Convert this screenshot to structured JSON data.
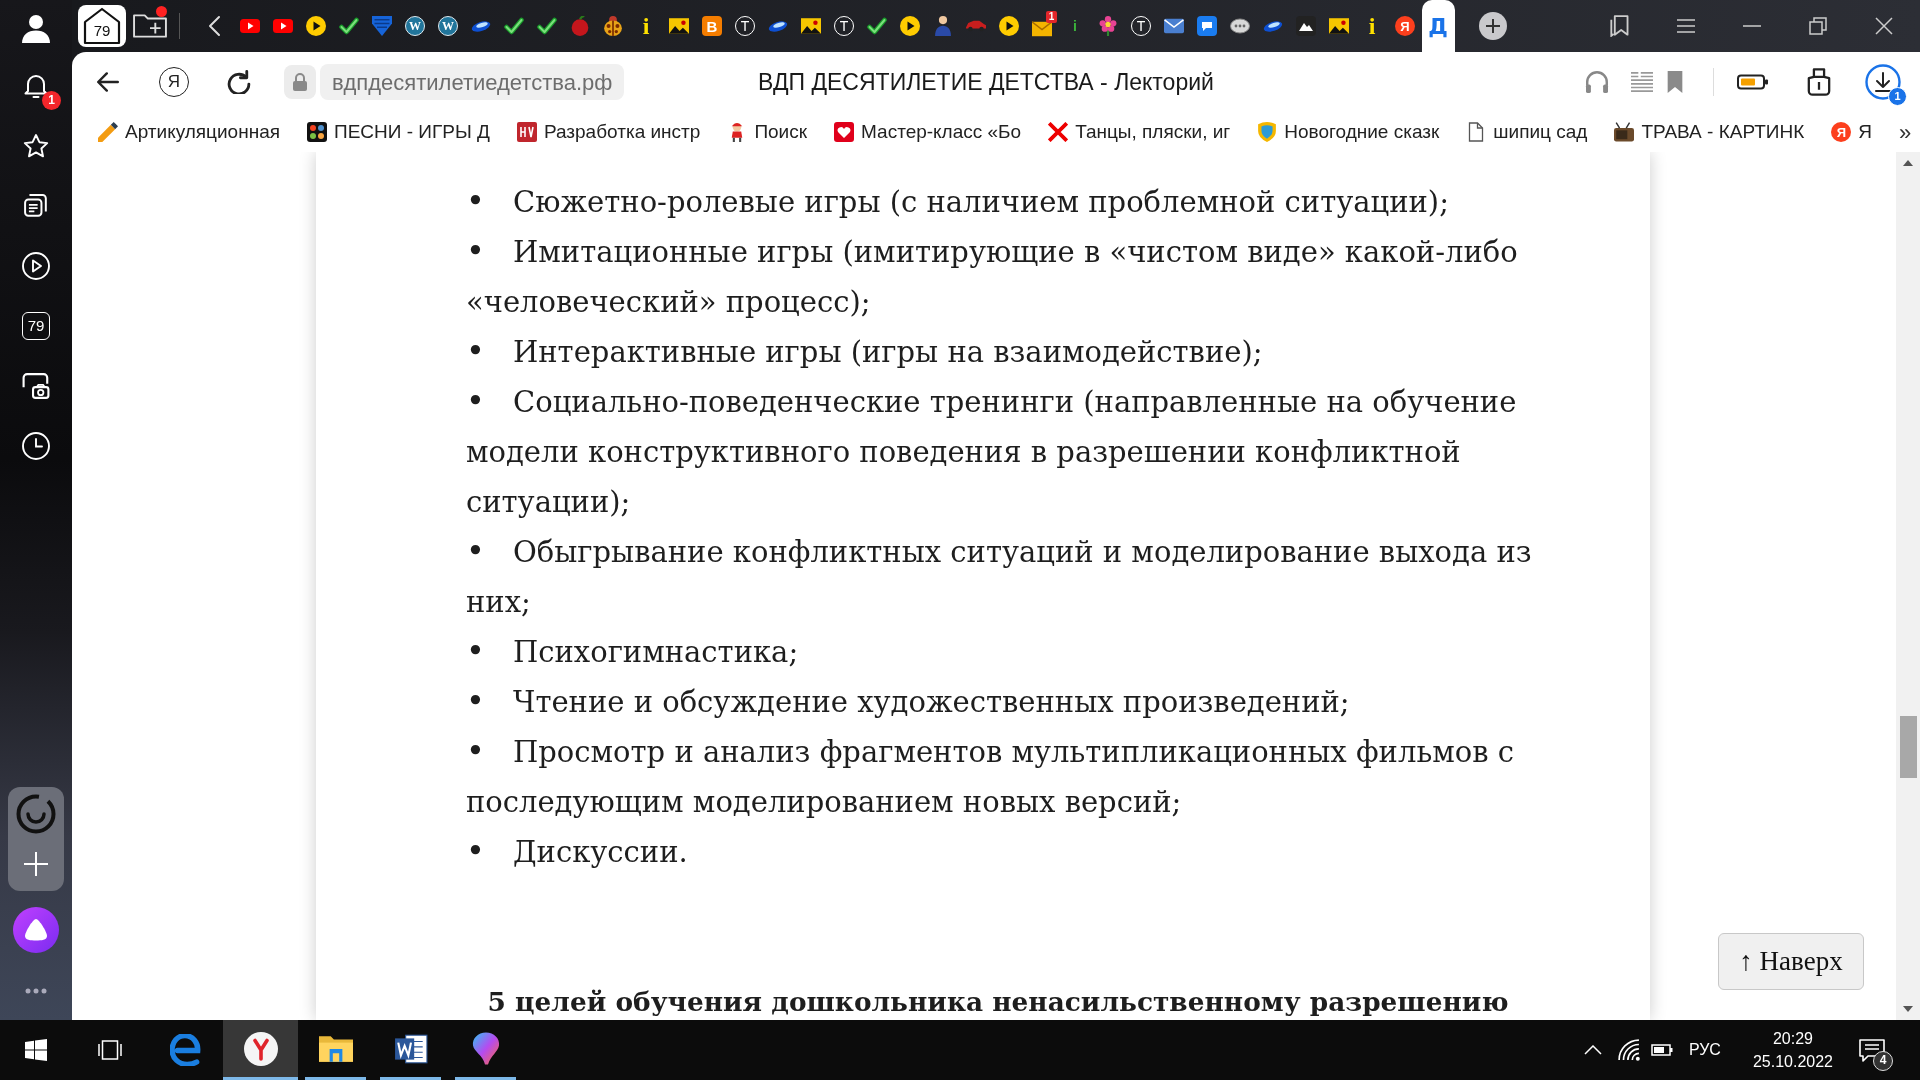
{
  "sidebar": {
    "notification_count": "1",
    "tab_count": "79"
  },
  "tab_strip": {
    "tabs_button": "79",
    "tabs": [
      {
        "kind": "youtube",
        "selected": false
      },
      {
        "kind": "youtube",
        "selected": false
      },
      {
        "kind": "play",
        "selected": false
      },
      {
        "kind": "check",
        "selected": false
      },
      {
        "kind": "shield",
        "selected": false
      },
      {
        "kind": "wordpress",
        "glyph": "W",
        "selected": false
      },
      {
        "kind": "wordpress",
        "glyph": "W",
        "selected": false
      },
      {
        "kind": "swoosh",
        "selected": false
      },
      {
        "kind": "check",
        "selected": false
      },
      {
        "kind": "check",
        "selected": false
      },
      {
        "kind": "apple",
        "selected": false
      },
      {
        "kind": "bug",
        "selected": false
      },
      {
        "kind": "info",
        "glyph": "i",
        "selected": false
      },
      {
        "kind": "picture",
        "selected": false
      },
      {
        "kind": "blogger",
        "glyph": "B",
        "selected": false
      },
      {
        "kind": "tilda",
        "glyph": "T",
        "selected": false
      },
      {
        "kind": "swoosh",
        "selected": false
      },
      {
        "kind": "picture",
        "selected": false
      },
      {
        "kind": "tilda",
        "glyph": "T",
        "selected": false
      },
      {
        "kind": "check",
        "selected": false
      },
      {
        "kind": "play",
        "selected": false
      },
      {
        "kind": "person",
        "selected": false
      },
      {
        "kind": "car",
        "selected": false
      },
      {
        "kind": "play",
        "selected": false
      },
      {
        "kind": "mail",
        "badge": "1",
        "selected": false
      },
      {
        "kind": "info-small",
        "glyph": "i",
        "selected": false
      },
      {
        "kind": "flower",
        "selected": false
      },
      {
        "kind": "tilda",
        "glyph": "T",
        "selected": false
      },
      {
        "kind": "envelope",
        "selected": false
      },
      {
        "kind": "chat",
        "selected": false
      },
      {
        "kind": "oval",
        "selected": false
      },
      {
        "kind": "swoosh",
        "selected": false
      },
      {
        "kind": "mountain",
        "selected": false
      },
      {
        "kind": "picture",
        "selected": false
      },
      {
        "kind": "info",
        "glyph": "i",
        "selected": false
      },
      {
        "kind": "yandex",
        "glyph": "Я",
        "selected": false
      },
      {
        "kind": "site",
        "glyph": "Д",
        "selected": true
      }
    ]
  },
  "toolbar": {
    "home_button": "Я",
    "address": "вдпдесятилетиедетства.рф",
    "page_title": "ВДП ДЕСЯТИЛЕТИЕ ДЕТСТВА - Лекторий",
    "downloads_count": "1"
  },
  "bookmarks": {
    "items": [
      {
        "kind": "pencil",
        "label": "Артикуляционная"
      },
      {
        "kind": "dots",
        "label": "ПЕСНИ - ИГРЫ Д"
      },
      {
        "kind": "tile",
        "label": "Разработка инстр"
      },
      {
        "kind": "figure",
        "label": "Поиск"
      },
      {
        "kind": "heart",
        "label": "Мастер-класс «Бо"
      },
      {
        "kind": "cross",
        "label": "Танцы, пляски, иг"
      },
      {
        "kind": "shield",
        "label": "Новогодние сказк"
      },
      {
        "kind": "document",
        "label": "шипиц сад"
      },
      {
        "kind": "tv",
        "label": "ТРАВА - КАРТИНК"
      },
      {
        "kind": "yandex",
        "glyph": "Я",
        "label": "Я"
      }
    ],
    "more": "»"
  },
  "article": {
    "items": [
      {
        "marker": "•",
        "text": "Сюжетно-ролевые игры (с наличием проблемной ситуации);"
      },
      {
        "marker": "•",
        "text": "Имитационные игры (имитирующие в «чистом виде» какой-либо «человеческий» процесс);"
      },
      {
        "marker": "•",
        "text": "Интерактивные игры (игры на взаимодействие);"
      },
      {
        "marker": "•",
        "text": "Социально-поведенческие тренинги (направленные на обучение модели конструктивного поведения в разрешении конфликтной ситуации);"
      },
      {
        "marker": "•",
        "text": "Обыгрывание конфликтных ситуаций и моделирование выхода из них;"
      },
      {
        "marker": "•",
        "text": "Психогимнастика;"
      },
      {
        "marker": "•",
        "text": "Чтение и обсуждение художественных произведений;"
      },
      {
        "marker": "•",
        "text": "Просмотр и анализ фрагментов мультипликационных фильмов с последующим моделированием новых версий;"
      },
      {
        "marker": "•",
        "text": "Дискуссии."
      }
    ],
    "heading": "5 целей обучения дошкольника ненасильственному разрешению"
  },
  "back_to_top": "↑ Наверх",
  "taskbar": {
    "apps": [
      {
        "kind": "edge",
        "running": false,
        "active": false
      },
      {
        "kind": "yandex",
        "running": true,
        "active": true
      },
      {
        "kind": "explorer",
        "running": true,
        "active": false
      },
      {
        "kind": "word",
        "running": true,
        "active": false
      },
      {
        "kind": "paint",
        "running": true,
        "active": false
      }
    ],
    "language": "РУС",
    "time": "20:29",
    "date": "25.10.2022",
    "notification_count": "4"
  }
}
